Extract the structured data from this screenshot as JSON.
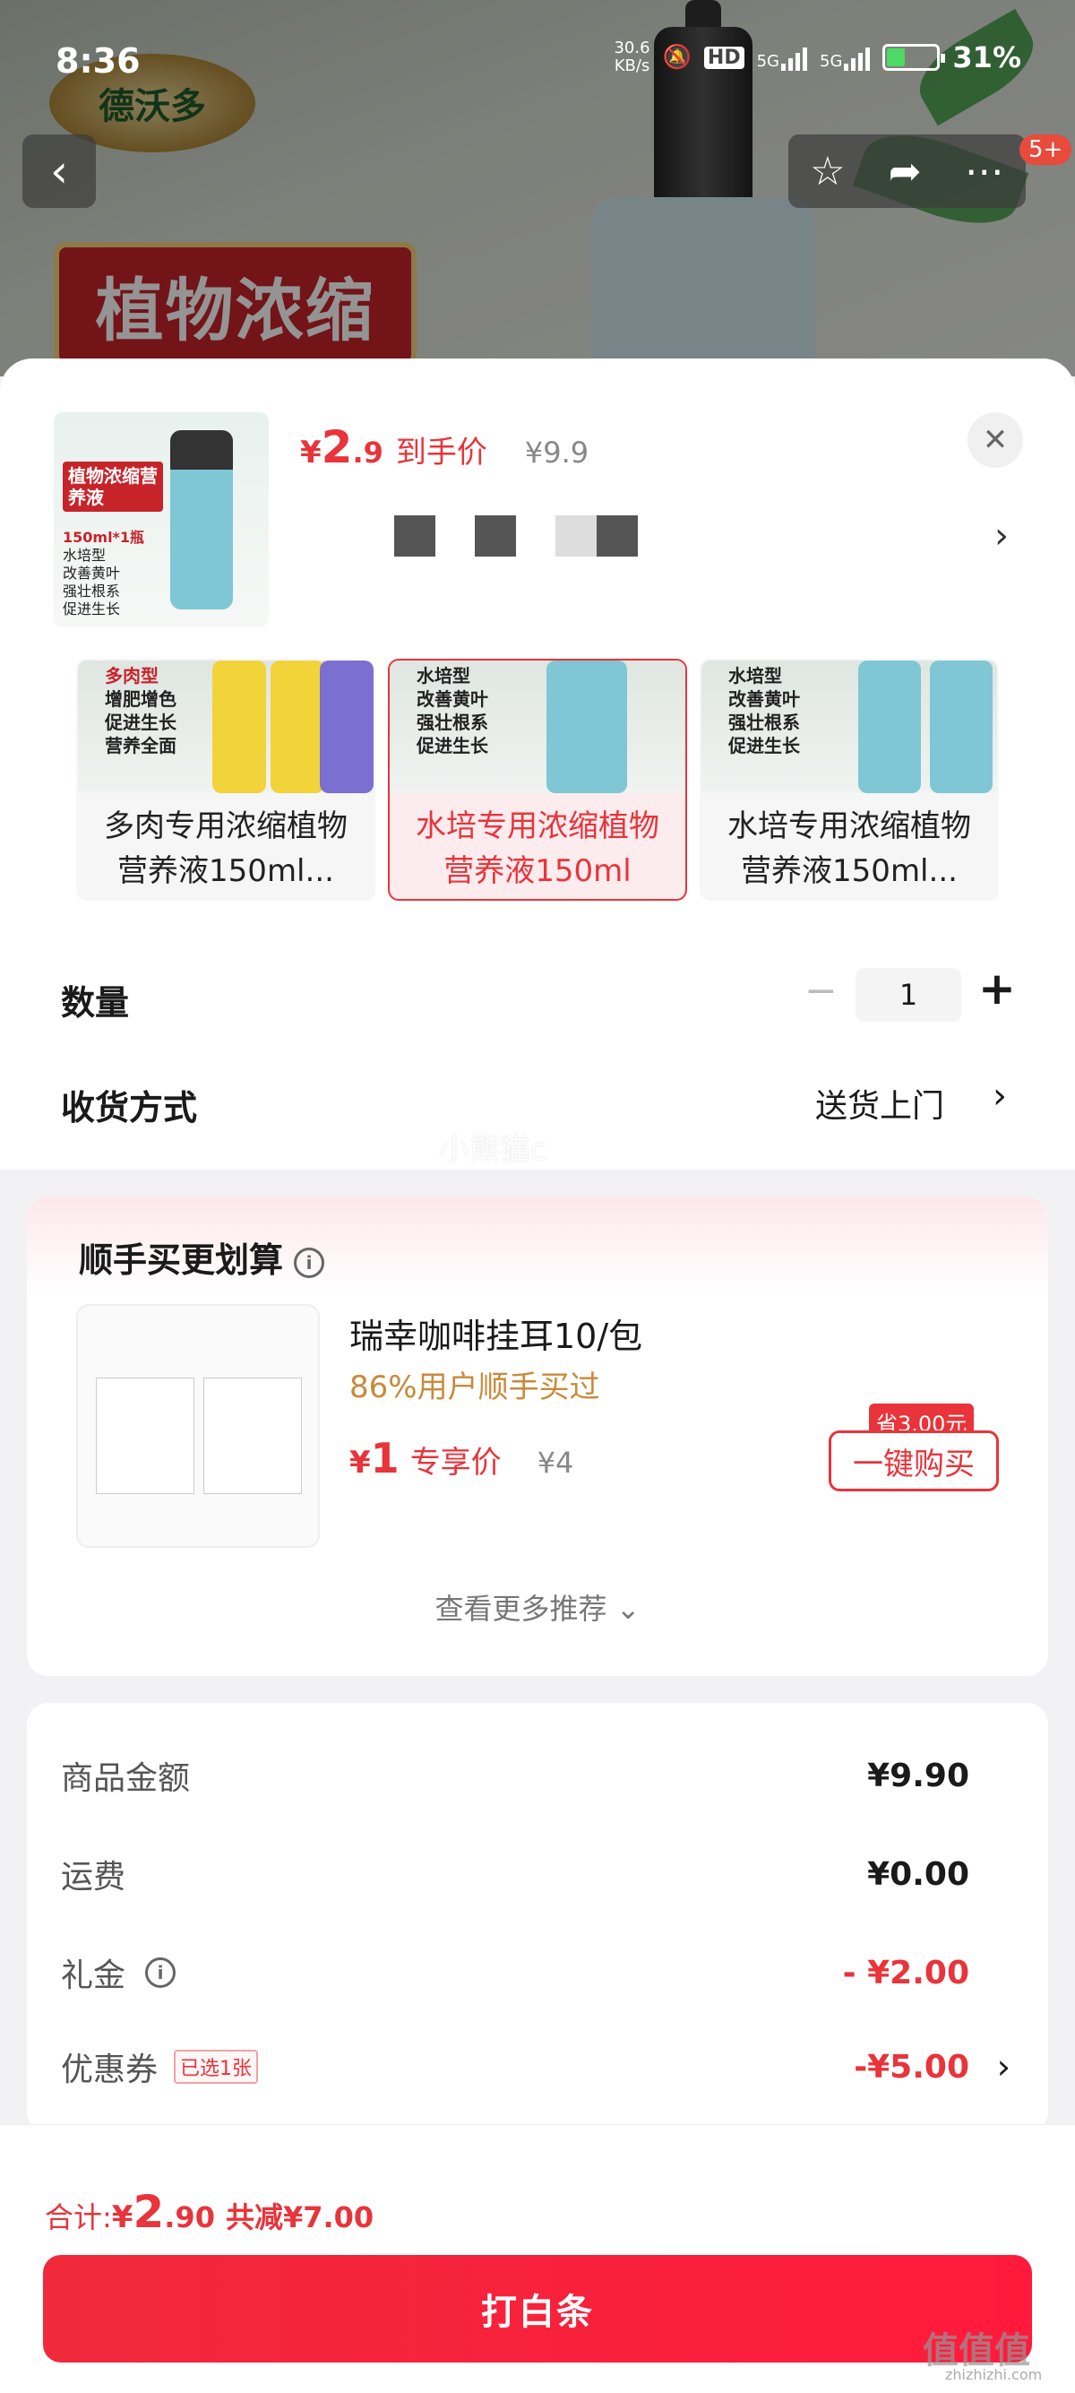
{
  "status_bar": {
    "time": "8:36",
    "net_speed_value": "30.6",
    "net_speed_unit": "KB/s",
    "hd_label": "HD",
    "signal1_label": "5G",
    "signal2_label": "5G",
    "battery_percent": "31%"
  },
  "background": {
    "brand_logo_text": "德沃多",
    "banner_text": "植物浓缩",
    "notification_badge": "5+"
  },
  "product": {
    "thumb_tag": "植物浓缩营养液",
    "thumb_lines": [
      "150ml*1瓶",
      "水培型",
      "改善黄叶",
      "强壮根系",
      "促进生长"
    ],
    "price_currency": "¥",
    "price_int": "2",
    "price_dec": ".9",
    "price_label": "到手价",
    "original_price": "¥9.9"
  },
  "variants": [
    {
      "title_line1": "多肉专用浓缩植物",
      "title_line2": "营养液150ml...",
      "note_lines": [
        "多肉型",
        "增肥增色",
        "促进生长",
        "营养全面"
      ],
      "selected": false
    },
    {
      "title_line1": "水培专用浓缩植物",
      "title_line2": "营养液150ml",
      "note_lines": [
        "水培型",
        "改善黄叶",
        "强壮根系",
        "促进生长"
      ],
      "selected": true
    },
    {
      "title_line1": "水培专用浓缩植物",
      "title_line2": "营养液150ml...",
      "note_lines": [
        "水培型",
        "改善黄叶",
        "强壮根系",
        "促进生长"
      ],
      "selected": false
    }
  ],
  "quantity": {
    "label": "数量",
    "value": "1"
  },
  "shipping": {
    "label": "收货方式",
    "value": "送货上门"
  },
  "watermark_user": "小熊猫c",
  "bundle": {
    "title": "顺手买更划算",
    "item_name": "瑞幸咖啡挂耳10/包",
    "social_proof": "86%用户顺手买过",
    "price_currency": "¥",
    "price_int": "1",
    "price_label": "专享价",
    "original_price": "¥4",
    "save_tag": "省3.00元",
    "buy_label": "一键购买",
    "more_label": "查看更多推荐"
  },
  "summary": {
    "rows": [
      {
        "label": "商品金额",
        "value": "¥9.90"
      },
      {
        "label": "运费",
        "value": "¥0.00"
      },
      {
        "label": "礼金",
        "value": "- ¥2.00"
      },
      {
        "label": "优惠券",
        "tag": "已选1张",
        "value": "-¥5.00"
      }
    ]
  },
  "footer": {
    "total_label": "合计: ",
    "total_currency": "¥",
    "total_int": "2",
    "total_dec": ".90",
    "total_saving": "共减¥7.00",
    "pay_button_label": "打白条"
  },
  "site_watermark": {
    "mark": "值值值",
    "url": "zhizhizhi.com"
  },
  "colors": {
    "accent": "#e8343a",
    "social": "#c98a3a"
  }
}
